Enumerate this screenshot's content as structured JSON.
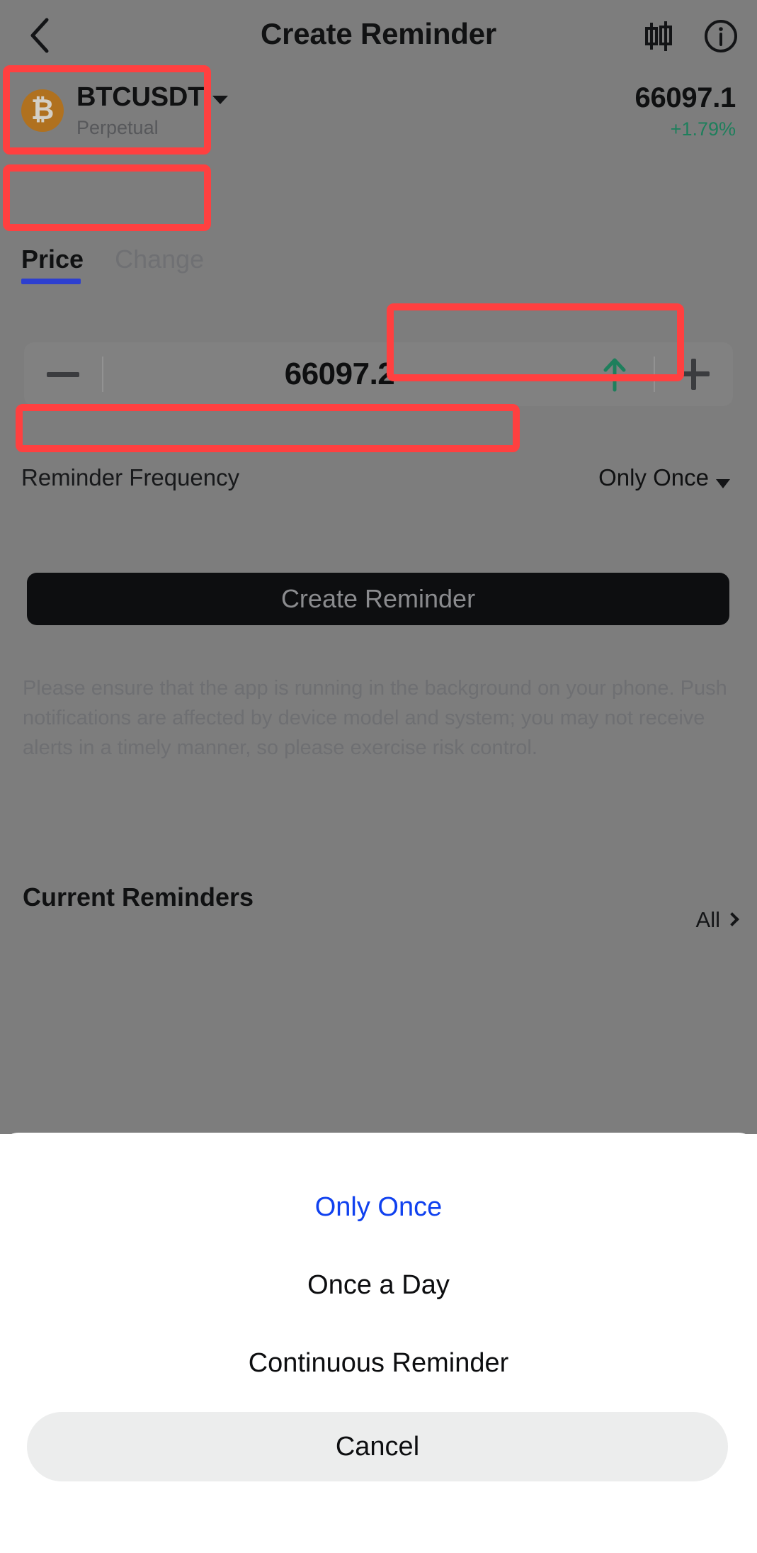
{
  "header": {
    "title": "Create Reminder",
    "back_icon": "chevron-left-icon",
    "candlestick_icon": "candlestick-chart-icon",
    "info_icon": "info-circle-icon"
  },
  "symbol": {
    "coin_glyph": "₿",
    "coin_color": "#b0711f",
    "name": "BTCUSDT",
    "subtitle": "Perpetual",
    "last_price": "66097.1",
    "change_pct": "+1.79%",
    "change_color": "#1e7f5c"
  },
  "tabs": [
    {
      "label": "Price",
      "active": true
    },
    {
      "label": "Change",
      "active": false
    }
  ],
  "tab_accent_color": "#2d3fcf",
  "stepper": {
    "minus_label": "−",
    "value": "66097.2",
    "direction_icon": "arrow-up-icon",
    "direction_color": "#1e7f5c",
    "plus_label": "+"
  },
  "frequency": {
    "label": "Reminder Frequency",
    "value": "Only Once"
  },
  "cta": {
    "label": "Create Reminder"
  },
  "disclaimer": {
    "text": "Please ensure that the app is running in the background on your phone. Push notifications are affected by device model and system; you may not receive alerts in a timely manner, so please exercise risk control."
  },
  "current_reminders": {
    "title": "Current Reminders",
    "all_label": "All"
  },
  "action_sheet": {
    "options": [
      {
        "label": "Only Once",
        "selected": true
      },
      {
        "label": "Once a Day",
        "selected": false
      },
      {
        "label": "Continuous Reminder",
        "selected": false
      }
    ],
    "cancel_label": "Cancel",
    "selected_color": "#1041ef"
  }
}
